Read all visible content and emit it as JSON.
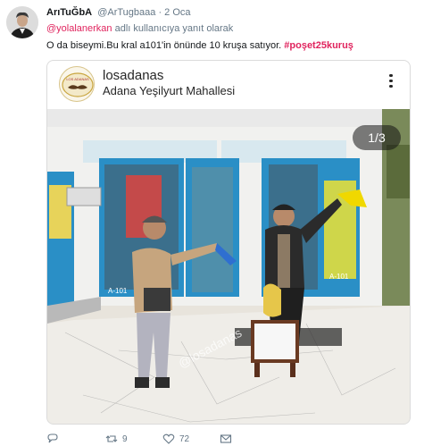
{
  "author": {
    "display_name": "ArıTuĞbA",
    "handle": "@ArTugbaaa",
    "separator": "·",
    "time": "2 Oca"
  },
  "reply": {
    "mention": "@yolalanerkan",
    "suffix": " adlı kullanıcıya yanıt olarak"
  },
  "tweet": {
    "text": "O da biseymi.Bu kral a101'in önünde 10 kruşa satıyor. ",
    "hashtag": "#poşet25kuruş"
  },
  "instagram": {
    "username": "losadanas",
    "location": "Adana Yeşilyurt Mahallesi",
    "counter": "1/3",
    "logo_text": "LOS ADANAS",
    "photo_watermark": "@losadanas",
    "store_sign": "A-101"
  },
  "actions": {
    "retweets": "9",
    "likes": "72"
  },
  "colors": {
    "accent_pink": "#e0245e",
    "muted": "#657786",
    "store_blue": "#2a8fc6"
  }
}
